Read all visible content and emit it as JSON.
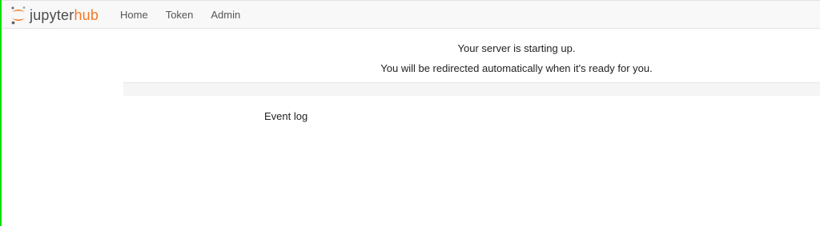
{
  "navbar": {
    "brand": {
      "logo_icon": "jupyter-logo-icon",
      "text_primary": "jupyter",
      "text_accent": "hub",
      "accent_color": "#f37726"
    },
    "links": [
      {
        "label": "Home"
      },
      {
        "label": "Token"
      },
      {
        "label": "Admin"
      }
    ]
  },
  "main": {
    "status_message": "Your server is starting up.",
    "redirect_message": "You will be redirected automatically when it's ready for you.",
    "progress": {
      "value_percent": 0
    },
    "event_log_label": "Event log"
  },
  "colors": {
    "left_edge": "#00e000",
    "navbar_bg": "#f8f8f8"
  }
}
